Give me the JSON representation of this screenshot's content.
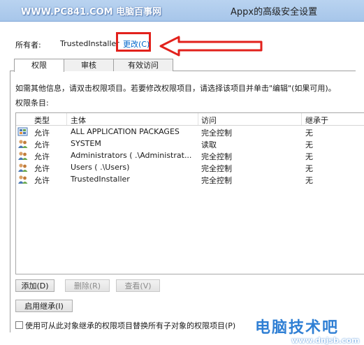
{
  "window": {
    "watermark": "WWW.PC841.COM 电脑百事网",
    "title": "Appx的高级安全设置"
  },
  "owner": {
    "label": "所有者:",
    "value": "TrustedInstaller",
    "change_link": "更改(C)"
  },
  "tabs": [
    {
      "label": "权限",
      "active": true
    },
    {
      "label": "审核",
      "active": false
    },
    {
      "label": "有效访问",
      "active": false
    }
  ],
  "info_text": "如需其他信息，请双击权限项目。若要修改权限项目，请选择该项目并单击\"编辑\"(如果可用)。",
  "entries_label": "权限条目:",
  "table": {
    "columns": [
      "类型",
      "主体",
      "访问",
      "继承于"
    ],
    "rows": [
      {
        "type": "允许",
        "principal": "ALL APPLICATION PACKAGES",
        "access": "完全控制",
        "inherited": "无",
        "icon": "app-packages-icon"
      },
      {
        "type": "允许",
        "principal": "SYSTEM",
        "access": "读取",
        "inherited": "无",
        "icon": "user-group-icon"
      },
      {
        "type": "允许",
        "principal": "Administrators (      .\\Administrat...",
        "access": "完全控制",
        "inherited": "无",
        "icon": "user-group-icon"
      },
      {
        "type": "允许",
        "principal": "Users (      .\\Users)",
        "access": "完全控制",
        "inherited": "无",
        "icon": "user-group-icon"
      },
      {
        "type": "允许",
        "principal": "TrustedInstaller",
        "access": "完全控制",
        "inherited": "无",
        "icon": "user-group-icon"
      }
    ]
  },
  "buttons": {
    "add": "添加(D)",
    "remove": "删除(R)",
    "view": "查看(V)",
    "enable_inheritance": "启用继承(I)"
  },
  "checkbox_label": "使用可从此对象继承的权限项目替换所有子对象的权限项目(P)",
  "logo": {
    "text": "电脑技术吧",
    "url": "www.dnjsb.com"
  },
  "colors": {
    "link": "#0066cc",
    "highlight": "#e2211c",
    "titlebar": "#b9d3f0"
  }
}
